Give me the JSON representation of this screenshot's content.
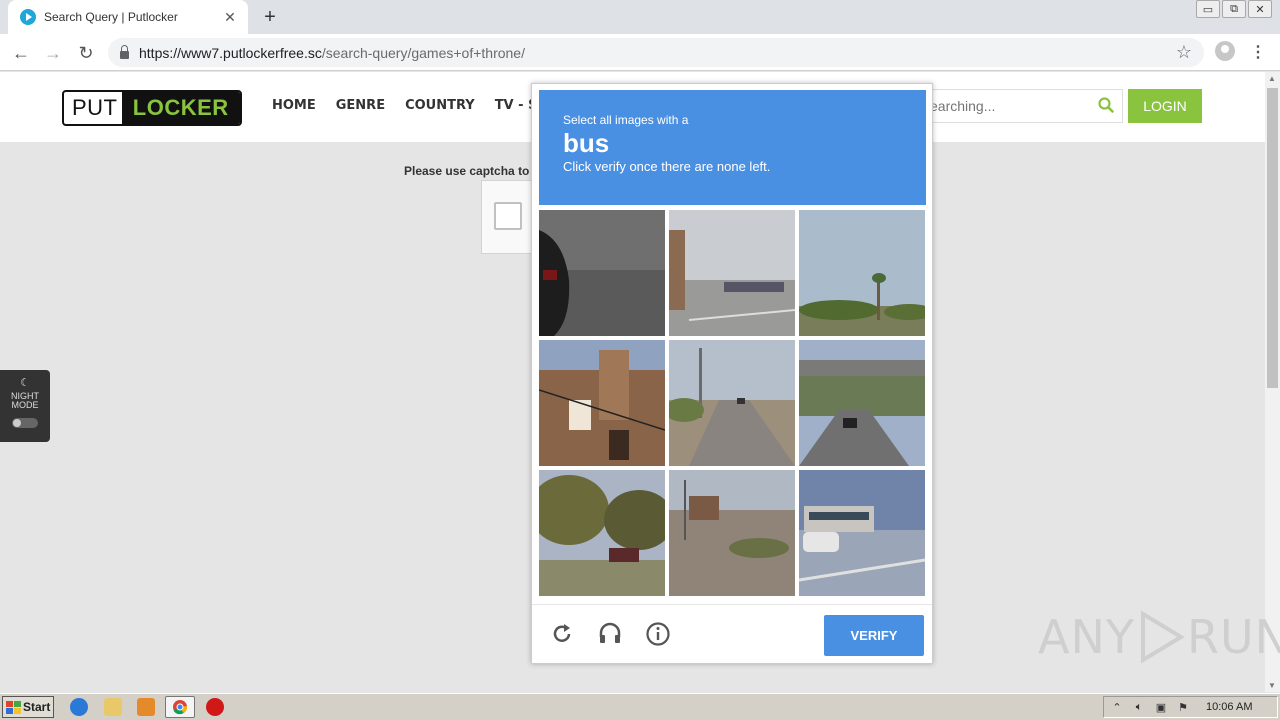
{
  "browser": {
    "tab_title": "Search Query | Putlocker",
    "tab_close": "✕",
    "new_tab": "+",
    "url_host": "https://www7.putlockerfree.sc",
    "url_path": "/search-query/games+of+throne/",
    "back": "←",
    "forward": "→",
    "reload": "↻",
    "star": "☆",
    "menu": "⋮",
    "window_buttons": [
      "▭",
      "⧉",
      "✕"
    ]
  },
  "site": {
    "logo_put": "PUT",
    "logo_locker": "LOCKER",
    "nav": [
      "HOME",
      "GENRE",
      "COUNTRY",
      "TV - SER"
    ],
    "search_placeholder": "earching...",
    "login": "LOGIN",
    "captcha_msg": "Please use captcha to",
    "night_mode_label": "NIGHT MODE",
    "moon": "☾"
  },
  "challenge": {
    "pre": "Select all images with a",
    "word": "bus",
    "post": "Click verify once there are none left.",
    "verify": "VERIFY",
    "tiles": [
      "car-door",
      "parking-lot",
      "palm-tree",
      "brick-building",
      "street-road",
      "overpass",
      "trees-street",
      "roundabout",
      "bus-street"
    ]
  },
  "watermark": {
    "left": "ANY",
    "right": "RUN"
  },
  "taskbar": {
    "start": "Start",
    "clock": "10:06 AM"
  },
  "colors": {
    "challenge_blue": "#4a90e2",
    "brand_green": "#8ac43f"
  }
}
